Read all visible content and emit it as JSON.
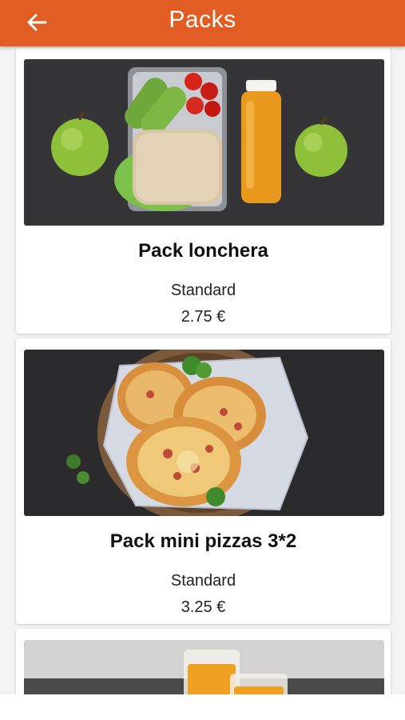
{
  "header": {
    "title": "Packs",
    "back_icon": "arrow-left-icon"
  },
  "colors": {
    "accent": "#e25d24",
    "background": "#f3f3f3"
  },
  "packs": [
    {
      "name": "Pack lonchera",
      "type": "Standard",
      "price": "2.75 €",
      "image": "lunchbox-photo"
    },
    {
      "name": "Pack mini pizzas 3*2",
      "type": "Standard",
      "price": "3.25 €",
      "image": "mini-pizzas-photo"
    },
    {
      "name": "",
      "type": "",
      "price": "",
      "image": "orange-juice-photo"
    }
  ]
}
